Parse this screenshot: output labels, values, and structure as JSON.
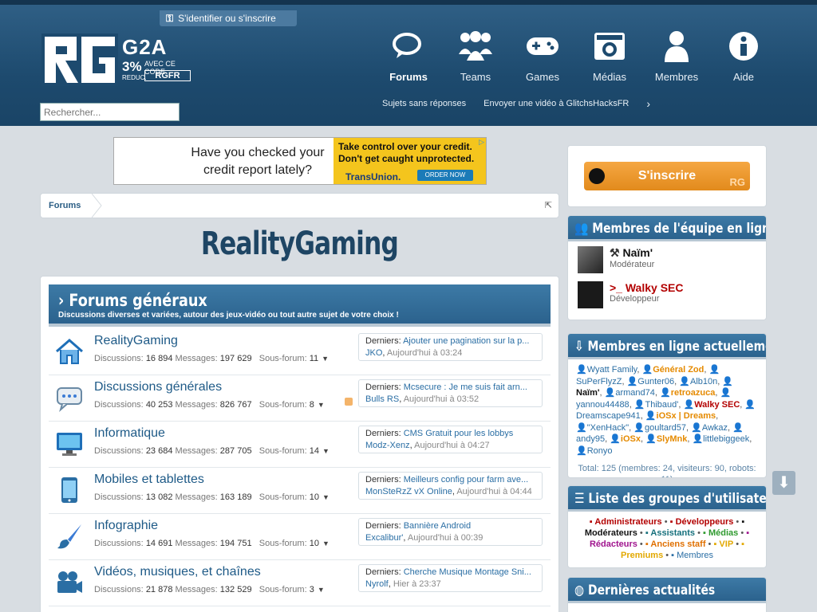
{
  "header": {
    "login_link": "S'identifier ou s'inscrire",
    "search_placeholder": "Rechercher...",
    "g2a": {
      "brand": "G2A",
      "percent": "3%",
      "avec": "AVEC CE CODE",
      "reduc": "REDUC.",
      "code": "RGFR"
    },
    "nav": [
      {
        "label": "Forums",
        "icon": "chat-bubbles-icon"
      },
      {
        "label": "Teams",
        "icon": "users-group-icon"
      },
      {
        "label": "Games",
        "icon": "gamepad-icon"
      },
      {
        "label": "Médias",
        "icon": "camera-icon"
      },
      {
        "label": "Membres",
        "icon": "user-icon"
      },
      {
        "label": "Aide",
        "icon": "info-icon"
      }
    ],
    "subnav": [
      "Sujets sans réponses",
      "Envoyer une vidéo à GlitchsHacksFR"
    ]
  },
  "ad": {
    "headline": "Have you checked your credit report lately?",
    "right_text": "Take control over your credit. Don't get caught unprotected.",
    "brand": "TransUnion.",
    "cta": "ORDER NOW"
  },
  "breadcrumb": {
    "label": "Forums"
  },
  "page_title": "RealityGaming",
  "category": {
    "title": "Forums généraux",
    "description": "Discussions diverses et variées, autour des jeux-vidéo ou tout autre sujet de votre choix !"
  },
  "labels": {
    "discussions": "Discussions:",
    "messages": "Messages:",
    "sousforum": "Sous-forum:",
    "derniers": "Derniers:"
  },
  "forums": [
    {
      "name": "RealityGaming",
      "discussions": "16 894",
      "messages": "197 629",
      "sub": "11",
      "last_title": "Ajouter une pagination sur la p...",
      "last_user": "JKO",
      "last_date": "Aujourd'hui à 03:24",
      "icon": "home-icon"
    },
    {
      "name": "Discussions générales",
      "discussions": "40 253",
      "messages": "826 767",
      "sub": "8",
      "last_title": "Mcsecure : Je me suis fait arn...",
      "last_user": "Bulls RS",
      "last_date": "Aujourd'hui à 03:52",
      "icon": "speech-bubble-icon"
    },
    {
      "name": "Informatique",
      "discussions": "23 684",
      "messages": "287 705",
      "sub": "14",
      "last_title": "CMS Gratuit pour les lobbys",
      "last_user": "Modz-Xenz",
      "last_date": "Aujourd'hui à 04:27",
      "icon": "monitor-icon"
    },
    {
      "name": "Mobiles et tablettes",
      "discussions": "13 082",
      "messages": "163 189",
      "sub": "10",
      "last_title": "Meilleurs config pour farm ave...",
      "last_user": "MonSteRzZ vX Online",
      "last_date": "Aujourd'hui à 04:44",
      "icon": "mobile-icon"
    },
    {
      "name": "Infographie",
      "discussions": "14 691",
      "messages": "194 751",
      "sub": "10",
      "last_title": "Bannière Android",
      "last_user": "Excalibur'",
      "last_date": "Aujourd'hui à 00:39",
      "icon": "paintbrush-icon"
    },
    {
      "name": "Vidéos, musiques, et chaînes",
      "discussions": "21 878",
      "messages": "132 529",
      "sub": "3",
      "last_title": "Cherche Musique Montage Sni...",
      "last_user": "Nyrolf",
      "last_date": "Hier à 23:37",
      "icon": "video-camera-icon"
    }
  ],
  "sidebar": {
    "signup": "S'inscrire",
    "staff_title": "Membres de l'équipe en ligne",
    "staff": [
      {
        "name": "Naïm'",
        "role": "Modérateur",
        "color": "#111111"
      },
      {
        "name": "Walky SEC",
        "role": "Développeur",
        "color": "#b30000"
      }
    ],
    "online_title": "Membres en ligne actuellement",
    "online": [
      {
        "n": "Wyatt Family",
        "c": "#2a6ea4"
      },
      {
        "n": "Général Zod",
        "c": "#e58a00"
      },
      {
        "n": "SuPerFlyzZ",
        "c": "#2a6ea4"
      },
      {
        "n": "Gunter06",
        "c": "#2a6ea4"
      },
      {
        "n": "Alb10n",
        "c": "#2a6ea4"
      },
      {
        "n": "Naïm'",
        "c": "#111111"
      },
      {
        "n": "armand74",
        "c": "#2a6ea4"
      },
      {
        "n": "retroazuca",
        "c": "#e58a00"
      },
      {
        "n": "yannou44488",
        "c": "#2a6ea4"
      },
      {
        "n": "Thibaud'",
        "c": "#2a6ea4"
      },
      {
        "n": "Walky SEC",
        "c": "#b30000"
      },
      {
        "n": "Dreamscape941",
        "c": "#2a6ea4"
      },
      {
        "n": "iOSx | Dreams",
        "c": "#e58a00"
      },
      {
        "n": "\"XenHack\"",
        "c": "#2a6ea4"
      },
      {
        "n": "goultard57",
        "c": "#2a6ea4"
      },
      {
        "n": "Awkaz",
        "c": "#2a6ea4"
      },
      {
        "n": "andy95",
        "c": "#2a6ea4"
      },
      {
        "n": "iOSx",
        "c": "#e58a00"
      },
      {
        "n": "SlyMnk",
        "c": "#e58a00"
      },
      {
        "n": "littlebiggeek",
        "c": "#2a6ea4"
      },
      {
        "n": "Ronyo",
        "c": "#2a6ea4"
      }
    ],
    "online_total": "Total: 125 (membres: 24, visiteurs: 90, robots: 11)",
    "groups_title": "Liste des groupes d'utilisateur",
    "groups": [
      {
        "n": "Administrateurs",
        "c": "#b30000"
      },
      {
        "n": "Développeurs",
        "c": "#b30000"
      },
      {
        "n": "Modérateurs",
        "c": "#111111"
      },
      {
        "n": "Assistants",
        "c": "#16707c"
      },
      {
        "n": "Médias",
        "c": "#2f9a2f"
      },
      {
        "n": "Rédacteurs",
        "c": "#a0148e"
      },
      {
        "n": "Anciens staff",
        "c": "#e07000"
      },
      {
        "n": "VIP",
        "c": "#e2a800"
      },
      {
        "n": "Premiums",
        "c": "#e2a800"
      },
      {
        "n": "Membres",
        "c": "#2a6ea4"
      }
    ],
    "news_title": "Dernières actualités"
  }
}
